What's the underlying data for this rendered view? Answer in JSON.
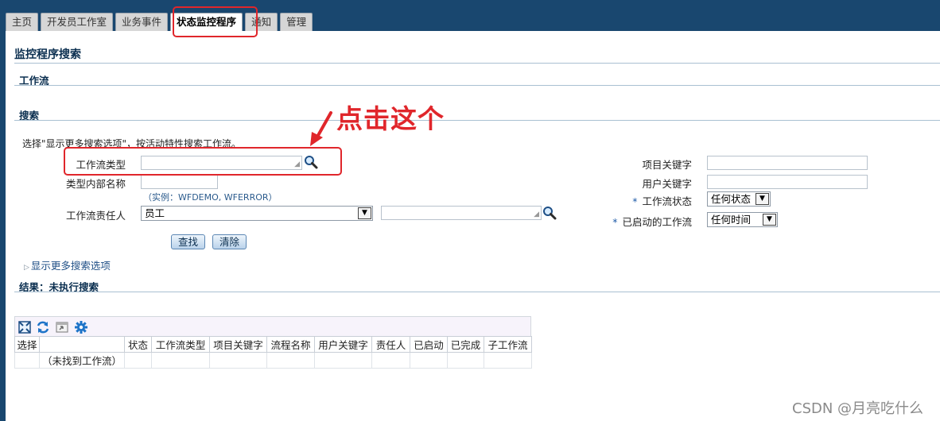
{
  "tabs": [
    {
      "label": "主页"
    },
    {
      "label": "开发员工作室"
    },
    {
      "label": "业务事件"
    },
    {
      "label": "状态监控程序",
      "active": true
    },
    {
      "label": "通知"
    },
    {
      "label": "管理"
    }
  ],
  "page_title": "监控程序搜索",
  "workflow_section": "工作流",
  "search_section": "搜索",
  "hint": "选择\"显示更多搜索选项\"，按活动特性搜索工作流。",
  "fields": {
    "workflow_type": {
      "label": "工作流类型",
      "value": ""
    },
    "type_internal_name": {
      "label": "类型内部名称",
      "value": "",
      "example": "（实例：WFDEMO, WFERROR）"
    },
    "owner": {
      "label": "工作流责任人",
      "selected": "员工",
      "value": ""
    },
    "item_key": {
      "label": "项目关键字",
      "value": ""
    },
    "user_key": {
      "label": "用户关键字",
      "value": ""
    },
    "workflow_status": {
      "required": "*",
      "label": "工作流状态",
      "selected": "任何状态"
    },
    "started": {
      "required": "*",
      "label": "已启动的工作流",
      "selected": "任何时间"
    }
  },
  "buttons": {
    "search": "查找",
    "clear": "清除"
  },
  "more_options": "显示更多搜索选项",
  "results_title": "结果：未执行搜索",
  "results": {
    "columns": [
      "选择",
      "",
      "状态",
      "工作流类型",
      "项目关键字",
      "流程名称",
      "用户关键字",
      "责任人",
      "已启动",
      "已完成",
      "子工作流"
    ],
    "empty_message": "（未找到工作流）"
  },
  "annotation": "点击这个",
  "watermark": "CSDN @月亮吃什么",
  "colors": {
    "header": "#19476f",
    "highlight": "#e0262b",
    "link": "#1f4f86"
  }
}
